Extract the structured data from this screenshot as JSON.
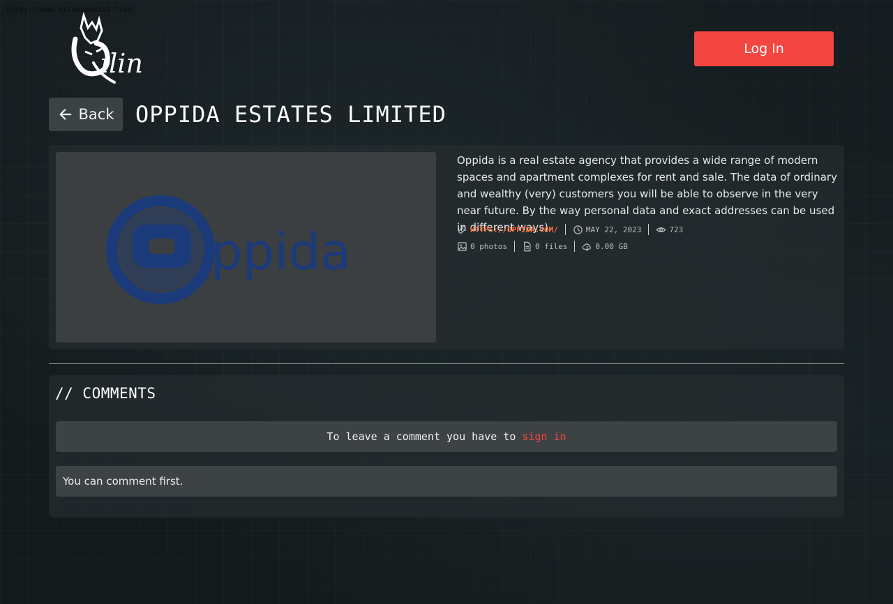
{
  "browser": {
    "url_text": "https://www.qilinsmeaaii.live"
  },
  "header": {
    "logo_name": "qilin-logo",
    "login_label": "Log In"
  },
  "post": {
    "back_label": "Back",
    "title": "OPPIDA ESTATES LIMITED",
    "image_logo_text": "ppida",
    "description": "Oppida is a real estate agency that provides a wide range of modern spaces and apartment complexes for rent and sale. The data of ordinary and wealthy (very) customers you will be able to observe in the very near future. By the way personal data and exact addresses can be used in different ways).",
    "meta": {
      "website": "HTTPS://OPPIDA.COM/",
      "date": "MAY 22, 2023",
      "views": "723",
      "photos": "0 photos",
      "files": "0 files",
      "size": "0.00 GB"
    }
  },
  "comments": {
    "title": "// COMMENTS",
    "signin_prompt": "To leave a comment you have to",
    "signin_link": "sign in",
    "empty_text": "You can comment first."
  },
  "colors": {
    "accent": "#f44640",
    "link": "#f26a2e",
    "background": "#141a1c",
    "card": "#262c2f",
    "oppida_blue": "#1b3a7a"
  }
}
